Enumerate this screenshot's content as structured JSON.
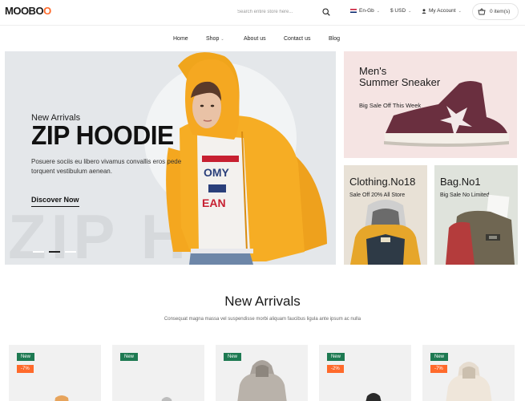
{
  "header": {
    "logo_main": "MOOBO",
    "logo_accent": "O",
    "search_placeholder": "Search entire store here...",
    "language": "En-Gb",
    "currency": "$ USD",
    "account": "My Account",
    "cart": "0 item(s)"
  },
  "nav": {
    "items": [
      "Home",
      "Shop",
      "About us",
      "Contact us",
      "Blog"
    ]
  },
  "hero": {
    "eyebrow": "New Arrivals",
    "title": "ZIP HOODIE",
    "description": "Posuere sociis eu libero vivamus convallis eros pede torquent vestibulum aenean.",
    "cta": "Discover Now",
    "watermark": "ZIP H"
  },
  "promos": [
    {
      "title_line1": "Men's",
      "title_line2": "Summer Sneaker",
      "subtitle": "Big Sale Off This Week"
    },
    {
      "title": "Clothing.No18",
      "subtitle": "Sale Off 20% All Store"
    },
    {
      "title": "Bag.No1",
      "subtitle": "Big Sale No Limited"
    }
  ],
  "new_arrivals": {
    "title": "New Arrivals",
    "description": "Consequat magna massa vel suspendisse morbi aliquam faucibus ligula ante ipsum ac nulla",
    "cards": [
      {
        "badge_new": "New",
        "badge_off": "-7%"
      },
      {
        "badge_new": "New",
        "badge_off": ""
      },
      {
        "badge_new": "New",
        "badge_off": ""
      },
      {
        "badge_new": "New",
        "badge_off": "-2%"
      },
      {
        "badge_new": "New",
        "badge_off": "-7%"
      }
    ]
  },
  "colors": {
    "accent": "#ff6a2b",
    "badge_new": "#1e7a52",
    "hoodie": "#f4a71f"
  }
}
